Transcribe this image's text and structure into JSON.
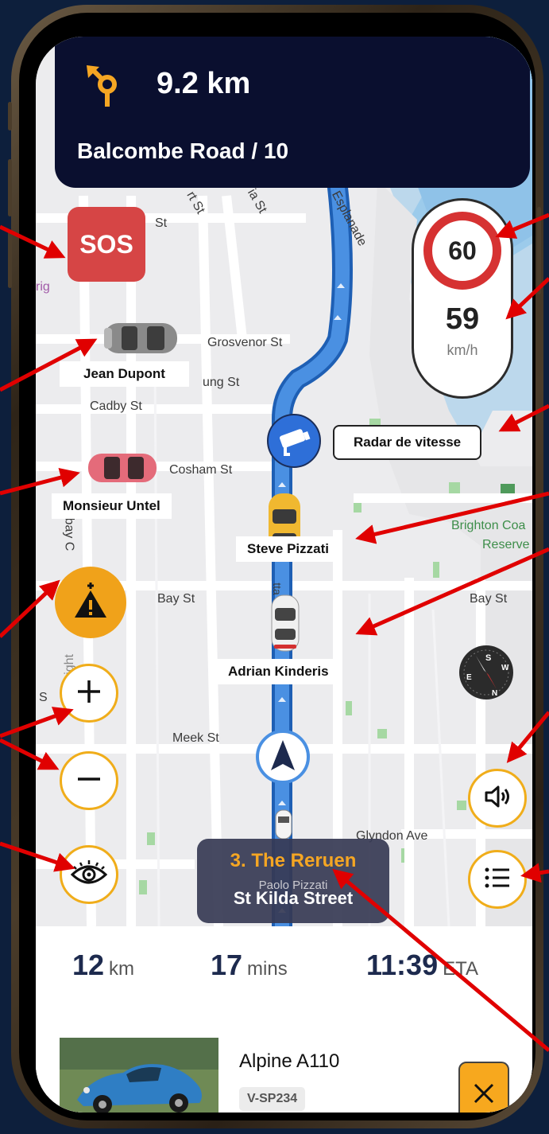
{
  "maneuver": {
    "distance": "9.2 km",
    "road": "Balcombe Road / 10"
  },
  "sos_label": "SOS",
  "speed": {
    "limit": "60",
    "current": "59",
    "unit": "km/h"
  },
  "streets": {
    "st_a": "St",
    "st_b": "rt St",
    "st_c": "ia St",
    "esplanade": "Esplanade",
    "grosvenor": "Grosvenor St",
    "ung": "ung St",
    "cadby": "Cadby St",
    "cosham": "Cosham St",
    "bay_left": "Bay St",
    "bay_right": "Bay St",
    "meek": "Meek St",
    "glyndon": "Glyndon Ave",
    "brighton1": "Brighton Coa",
    "brighton2": "Reserve",
    "rig": "rig",
    "nbay": "nbay C",
    "wright": "Wright",
    "s_left": "S",
    "tta": "tta"
  },
  "drivers": {
    "jean": "Jean Dupont",
    "untel": "Monsieur Untel",
    "steve": "Steve Pizzati",
    "adrian": "Adrian Kinderis"
  },
  "radar_label": "Radar de vitesse",
  "nav_card": {
    "title": "3. The Reruen",
    "street": "St Kilda Street",
    "driver": "Paolo Pizzati"
  },
  "stats": {
    "distance_value": "12",
    "distance_unit": "km",
    "time_value": "17",
    "time_unit": "mins",
    "eta_value": "11:39",
    "eta_unit": "ETA"
  },
  "vehicle": {
    "name": "Alpine A110",
    "plate": "V-SP234"
  },
  "icons": [
    "roundabout-turn-icon",
    "radar-camera-icon",
    "hazard-report-icon",
    "zoom-in-icon",
    "zoom-out-icon",
    "eye-icon",
    "compass-icon",
    "speaker-icon",
    "list-icon",
    "close-icon",
    "navigation-arrow-icon",
    "car-icon"
  ],
  "colors": {
    "accent": "#f0ad1a",
    "route": "#4a90e2",
    "sos": "#d64545",
    "topbar": "#0a0f2f",
    "annotation": "#e00000"
  }
}
